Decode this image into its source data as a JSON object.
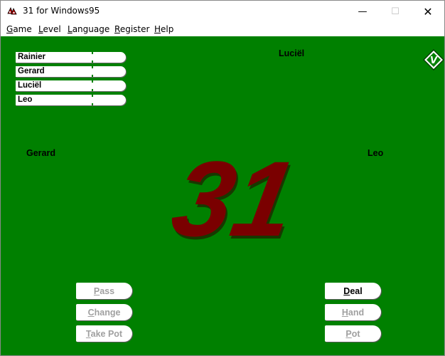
{
  "window": {
    "title": "31 for Windows95"
  },
  "menu": {
    "items": [
      {
        "first": "G",
        "rest": "ame"
      },
      {
        "first": "L",
        "rest": "evel"
      },
      {
        "first": "L",
        "rest": "anguage"
      },
      {
        "first": "R",
        "rest": "egister"
      },
      {
        "first": "H",
        "rest": "elp"
      }
    ]
  },
  "scoreboard": [
    "Rainier",
    "Gerard",
    "Luciël",
    "Leo"
  ],
  "seats": {
    "top": "Luciël",
    "left": "Gerard",
    "right": "Leo"
  },
  "logo": {
    "text": "31",
    "color": "#7a0000"
  },
  "badge": {
    "text": "V"
  },
  "buttons": {
    "pass": {
      "first": "P",
      "rest": "ass",
      "enabled": false
    },
    "change": {
      "first": "C",
      "rest": "hange",
      "enabled": false
    },
    "takepot": {
      "first": "T",
      "rest": "ake Pot",
      "enabled": false
    },
    "deal": {
      "first": "D",
      "rest": "eal",
      "enabled": true
    },
    "hand": {
      "first": "H",
      "rest": "and",
      "enabled": false
    },
    "pot": {
      "first": "P",
      "rest": "ot",
      "enabled": false
    }
  },
  "colors": {
    "felt": "#008000",
    "disabled_text": "#a0a0a0"
  }
}
